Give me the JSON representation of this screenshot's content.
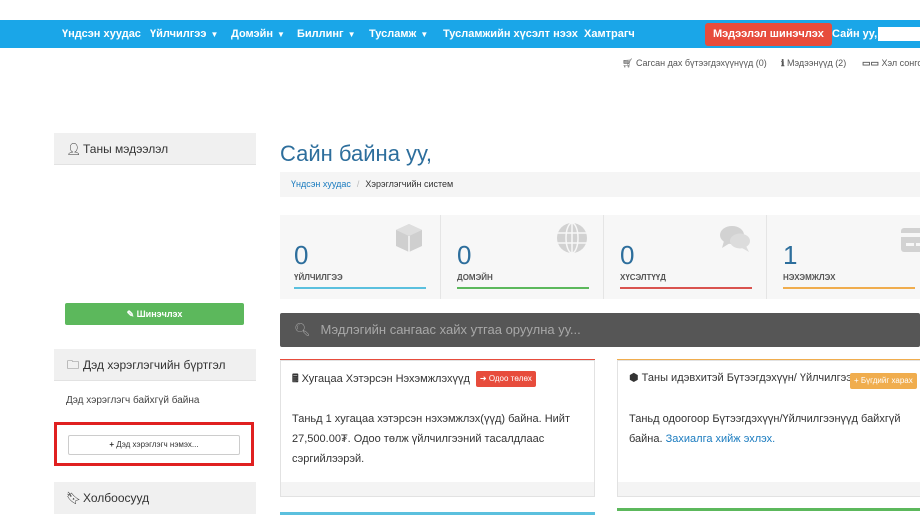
{
  "nav": {
    "items": [
      {
        "label": "Үндсэн хуудас",
        "caret": false
      },
      {
        "label": "Үйлчилгээ",
        "caret": true
      },
      {
        "label": "Домэйн",
        "caret": true
      },
      {
        "label": "Биллинг",
        "caret": true
      },
      {
        "label": "Тусламж",
        "caret": true
      },
      {
        "label": "Тусламжийн хүсэлт нээх",
        "caret": false
      },
      {
        "label": "Хамтрагч",
        "caret": false
      }
    ],
    "update_button": "Мэдээлэл шинэчлэх",
    "greeting": "Сайн уу,"
  },
  "subbar": {
    "cart": "Сагсан дах бүтээгдэхүүнүүд (0)",
    "notices": "Мэдээнүүд (2)",
    "language": "Хэл сонго"
  },
  "sidebar": {
    "info": {
      "title": "Таны мэдээлэл",
      "button": "Шинэчлэх"
    },
    "subaccounts": {
      "title": "Дэд хэрэглэгчийн бүртгэл",
      "empty_text": "Дэд хэрэглэгч байхгүй байна",
      "button": "Дэд хэрэглэгч нэмэх..."
    },
    "links": {
      "title": "Холбоосууд"
    }
  },
  "main": {
    "title": "Сайн байна уу,",
    "breadcrumb": {
      "home": "Үндсэн хуудас",
      "current": "Хэрэглэгчийн систем"
    },
    "tiles": [
      {
        "value": "0",
        "label": "ҮЙЛЧИЛГЭЭ",
        "color": "#5bc0de",
        "icon": "cube-icon"
      },
      {
        "value": "0",
        "label": "ДОМЭЙН",
        "color": "#5cb85c",
        "icon": "globe-icon"
      },
      {
        "value": "0",
        "label": "ХҮСЭЛТҮҮД",
        "color": "#d9534f",
        "icon": "chat-icon"
      },
      {
        "value": "1",
        "label": "НЭХЭМЖЛЭХ",
        "color": "#f0ad4e",
        "icon": "card-icon"
      }
    ],
    "search_placeholder": "Мэдлэгийн сангаас хайх утгаа оруулна уу...",
    "invoice_card": {
      "title": "Хугацаа Хэтэрсэн Нэхэмжлэхүүд",
      "badge": "Одоо төлөх",
      "badge_color": "#e74c3c",
      "body": "Таньд 1 хугацаа хэтэрсэн нэхэмжлэх(үүд) байна. Нийт 27,500.00₮. Одоо төлж үйлчилгээний тасалдлаас сэргийлээрэй."
    },
    "products_card": {
      "title": "Таны идэвхитэй Бүтээгдэхүүн/ Үйлчилгээнүүд",
      "badge": "Бүгдийг харах",
      "badge_color": "#f0ad4e",
      "body": "Таньд одоогоор Бүтээгдэхүүн/Үйлчилгээнүүд байхгүй байна.",
      "link": "Захиалга хийж эхлэх."
    }
  }
}
